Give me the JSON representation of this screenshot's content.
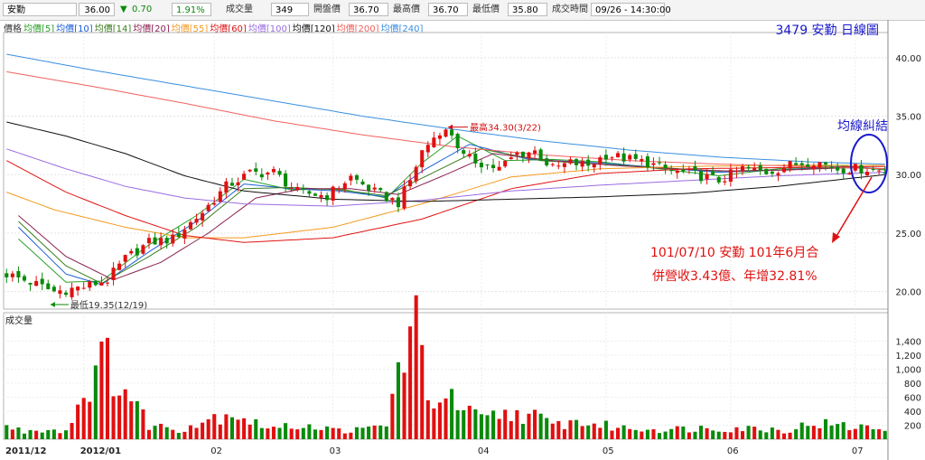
{
  "info_bar": {
    "name": "安勤",
    "price": "36.00",
    "change_arrow": "▼",
    "change": "0.70",
    "change_pct": "1.91%",
    "volume_label": "成交量",
    "volume": "349",
    "open_label": "開盤價",
    "open": "36.70",
    "high_label": "最高價",
    "high": "36.70",
    "low_label": "最低價",
    "low": "35.80",
    "time_label": "成交時間",
    "time": "09/26 - 14:30:00"
  },
  "legend": [
    {
      "label": "價格",
      "color": "#333333"
    },
    {
      "label": "均價[5]",
      "color": "#2aa02a"
    },
    {
      "label": "均價[10]",
      "color": "#1c5fd8"
    },
    {
      "label": "均價[14]",
      "color": "#3a7d1f"
    },
    {
      "label": "均價[20]",
      "color": "#8b2252"
    },
    {
      "label": "均價[55]",
      "color": "#f39a1e"
    },
    {
      "label": "均價[60]",
      "color": "#e01414"
    },
    {
      "label": "均價[100]",
      "color": "#9a6ce0"
    },
    {
      "label": "均價[120]",
      "color": "#111111"
    },
    {
      "label": "均價[200]",
      "color": "#f0625e"
    },
    {
      "label": "均價[240]",
      "color": "#3a8fe0"
    }
  ],
  "chart_data": {
    "type": "candlestick",
    "title": "3479 安勤 日線圖",
    "volume_panel_label": "成交量",
    "months": [
      "2011/12",
      "2012/01",
      "02",
      "03",
      "04",
      "05",
      "06",
      "07"
    ],
    "price_ylim": [
      18.5,
      42
    ],
    "price_ticks": [
      "40.00",
      "35.00",
      "30.00",
      "25.00",
      "20.00"
    ],
    "volume_ylim": [
      0,
      1600
    ],
    "volume_ticks": [
      "1,400",
      "1,200",
      "1,000",
      "800",
      "600",
      "400",
      "200"
    ],
    "high_annotation": {
      "label": "最高34.30(3/22)",
      "value": 34.3
    },
    "low_annotation": {
      "label": "最低19.35(12/19)",
      "value": 19.35
    },
    "callout": {
      "title": "均線糾結",
      "line1": "101/07/10  安勤 101年6月合",
      "line2": "併營收3.43億、年增32.81%"
    },
    "price_anchors": [
      [
        0,
        21.5
      ],
      [
        4,
        20.8
      ],
      [
        8,
        20
      ],
      [
        13,
        20.4
      ],
      [
        17,
        21
      ],
      [
        20,
        22.8
      ],
      [
        24,
        24.2
      ],
      [
        28,
        24.5
      ],
      [
        33,
        26.8
      ],
      [
        37,
        29
      ],
      [
        41,
        30.1
      ],
      [
        45,
        30.2
      ],
      [
        49,
        28.5
      ],
      [
        54,
        28.2
      ],
      [
        58,
        29.8
      ],
      [
        62,
        28.5
      ],
      [
        66,
        27.6
      ],
      [
        68,
        29.5
      ],
      [
        70,
        32
      ],
      [
        73,
        33.8
      ],
      [
        75,
        33.5
      ],
      [
        77,
        31.5
      ],
      [
        80,
        31
      ],
      [
        83,
        30.5
      ],
      [
        86,
        31.8
      ],
      [
        89,
        32
      ],
      [
        92,
        30.5
      ],
      [
        95,
        31
      ],
      [
        98,
        30.8
      ],
      [
        101,
        31.7
      ],
      [
        104,
        31.4
      ],
      [
        108,
        31
      ],
      [
        112,
        30.3
      ],
      [
        116,
        30
      ],
      [
        120,
        29.5
      ],
      [
        124,
        30.5
      ],
      [
        128,
        30.2
      ],
      [
        132,
        30.8
      ],
      [
        136,
        31.2
      ],
      [
        140,
        30.5
      ],
      [
        145,
        30.5
      ],
      [
        148,
        30.3
      ]
    ],
    "volume_anchors": [
      [
        0,
        180
      ],
      [
        3,
        110
      ],
      [
        6,
        150
      ],
      [
        10,
        120
      ],
      [
        14,
        850
      ],
      [
        17,
        1120
      ],
      [
        20,
        700
      ],
      [
        24,
        210
      ],
      [
        29,
        140
      ],
      [
        34,
        290
      ],
      [
        38,
        400
      ],
      [
        42,
        220
      ],
      [
        46,
        150
      ],
      [
        50,
        220
      ],
      [
        55,
        130
      ],
      [
        60,
        130
      ],
      [
        64,
        210
      ],
      [
        67,
        1340
      ],
      [
        69,
        1580
      ],
      [
        71,
        500
      ],
      [
        73,
        700
      ],
      [
        76,
        450
      ],
      [
        80,
        280
      ],
      [
        84,
        360
      ],
      [
        88,
        360
      ],
      [
        92,
        200
      ],
      [
        96,
        250
      ],
      [
        100,
        200
      ],
      [
        104,
        160
      ],
      [
        108,
        150
      ],
      [
        112,
        140
      ],
      [
        116,
        160
      ],
      [
        120,
        160
      ],
      [
        124,
        160
      ],
      [
        128,
        150
      ],
      [
        132,
        130
      ],
      [
        136,
        240
      ],
      [
        140,
        190
      ],
      [
        144,
        170
      ],
      [
        148,
        150
      ]
    ],
    "moving_averages": [
      {
        "name": "均價[5]",
        "color": "#2aa02a",
        "points": [
          [
            2,
            24.5
          ],
          [
            10,
            20.8
          ],
          [
            16,
            20.9
          ],
          [
            24,
            24
          ],
          [
            32,
            26.5
          ],
          [
            40,
            29.6
          ],
          [
            48,
            28.7
          ],
          [
            56,
            28.8
          ],
          [
            64,
            28
          ],
          [
            70,
            31
          ],
          [
            76,
            33.3
          ],
          [
            84,
            31.2
          ],
          [
            92,
            31.3
          ],
          [
            100,
            31.1
          ],
          [
            110,
            30.5
          ],
          [
            120,
            29.9
          ],
          [
            130,
            30.5
          ],
          [
            140,
            30.8
          ],
          [
            148,
            30.4
          ]
        ]
      },
      {
        "name": "均價[10]",
        "color": "#1c5fd8",
        "points": [
          [
            2,
            25.5
          ],
          [
            10,
            21.5
          ],
          [
            16,
            20.6
          ],
          [
            24,
            23.4
          ],
          [
            32,
            26
          ],
          [
            40,
            29.2
          ],
          [
            48,
            28.8
          ],
          [
            56,
            28.6
          ],
          [
            64,
            28.1
          ],
          [
            70,
            30.3
          ],
          [
            78,
            32.6
          ],
          [
            88,
            31.3
          ],
          [
            100,
            31
          ],
          [
            110,
            30.6
          ],
          [
            120,
            30.2
          ],
          [
            130,
            30.4
          ],
          [
            140,
            30.7
          ],
          [
            148,
            30.5
          ]
        ]
      },
      {
        "name": "均價[14]",
        "color": "#3a7d1f",
        "points": [
          [
            2,
            26
          ],
          [
            10,
            22.2
          ],
          [
            16,
            20.7
          ],
          [
            24,
            23
          ],
          [
            32,
            25.5
          ],
          [
            40,
            28.8
          ],
          [
            48,
            28.9
          ],
          [
            56,
            28.7
          ],
          [
            64,
            28.2
          ],
          [
            72,
            30.2
          ],
          [
            80,
            32.2
          ],
          [
            90,
            31.2
          ],
          [
            100,
            30.9
          ],
          [
            110,
            30.6
          ],
          [
            120,
            30.3
          ],
          [
            130,
            30.4
          ],
          [
            140,
            30.6
          ],
          [
            148,
            30.5
          ]
        ]
      },
      {
        "name": "均價[20]",
        "color": "#8b2252",
        "points": [
          [
            2,
            26.5
          ],
          [
            10,
            23
          ],
          [
            18,
            21
          ],
          [
            26,
            22.5
          ],
          [
            34,
            25
          ],
          [
            42,
            28
          ],
          [
            50,
            28.8
          ],
          [
            58,
            28.8
          ],
          [
            66,
            28.3
          ],
          [
            74,
            30
          ],
          [
            82,
            31.8
          ],
          [
            92,
            31.2
          ],
          [
            102,
            30.8
          ],
          [
            112,
            30.5
          ],
          [
            122,
            30.3
          ],
          [
            132,
            30.4
          ],
          [
            142,
            30.6
          ],
          [
            148,
            30.5
          ]
        ]
      },
      {
        "name": "均價[55]",
        "color": "#f39a1e",
        "points": [
          [
            0,
            28.5
          ],
          [
            8,
            27
          ],
          [
            20,
            25.5
          ],
          [
            30,
            24.6
          ],
          [
            40,
            24.6
          ],
          [
            55,
            25.5
          ],
          [
            70,
            27.5
          ],
          [
            85,
            29.8
          ],
          [
            100,
            30.5
          ],
          [
            115,
            30.7
          ],
          [
            130,
            30.8
          ],
          [
            148,
            30.8
          ]
        ]
      },
      {
        "name": "均價[60]",
        "color": "#e01414",
        "points": [
          [
            0,
            31.2
          ],
          [
            10,
            28.5
          ],
          [
            20,
            26.5
          ],
          [
            30,
            24.8
          ],
          [
            40,
            24.2
          ],
          [
            55,
            24.6
          ],
          [
            70,
            26.2
          ],
          [
            85,
            28.8
          ],
          [
            100,
            30.1
          ],
          [
            115,
            30.5
          ],
          [
            130,
            30.6
          ],
          [
            148,
            30.7
          ]
        ]
      },
      {
        "name": "均價[100]",
        "color": "#9a6ce0",
        "points": [
          [
            0,
            32.2
          ],
          [
            10,
            30.5
          ],
          [
            20,
            29
          ],
          [
            30,
            28
          ],
          [
            40,
            27.5
          ],
          [
            55,
            27.3
          ],
          [
            70,
            27.8
          ],
          [
            85,
            28.6
          ],
          [
            100,
            29.1
          ],
          [
            115,
            29.5
          ],
          [
            130,
            29.9
          ],
          [
            148,
            30.2
          ]
        ]
      },
      {
        "name": "均價[120]",
        "color": "#111111",
        "points": [
          [
            0,
            34.5
          ],
          [
            10,
            33.3
          ],
          [
            20,
            31.8
          ],
          [
            30,
            29.9
          ],
          [
            40,
            28.6
          ],
          [
            55,
            27.9
          ],
          [
            70,
            27.7
          ],
          [
            85,
            27.9
          ],
          [
            100,
            28.1
          ],
          [
            115,
            28.4
          ],
          [
            130,
            29
          ],
          [
            148,
            30
          ]
        ]
      },
      {
        "name": "均價[200]",
        "color": "#f0625e",
        "points": [
          [
            0,
            38.8
          ],
          [
            15,
            37.5
          ],
          [
            30,
            36.1
          ],
          [
            45,
            34.6
          ],
          [
            60,
            33.4
          ],
          [
            75,
            32.4
          ],
          [
            90,
            31.7
          ],
          [
            105,
            31.2
          ],
          [
            120,
            30.9
          ],
          [
            135,
            30.7
          ],
          [
            148,
            30.5
          ]
        ]
      },
      {
        "name": "均價[240]",
        "color": "#3a8fe0",
        "points": [
          [
            0,
            40.3
          ],
          [
            15,
            38.9
          ],
          [
            30,
            37.6
          ],
          [
            45,
            36.3
          ],
          [
            60,
            35
          ],
          [
            75,
            33.9
          ],
          [
            90,
            32.9
          ],
          [
            105,
            32.1
          ],
          [
            120,
            31.5
          ],
          [
            135,
            31.1
          ],
          [
            148,
            30.9
          ]
        ]
      }
    ]
  }
}
